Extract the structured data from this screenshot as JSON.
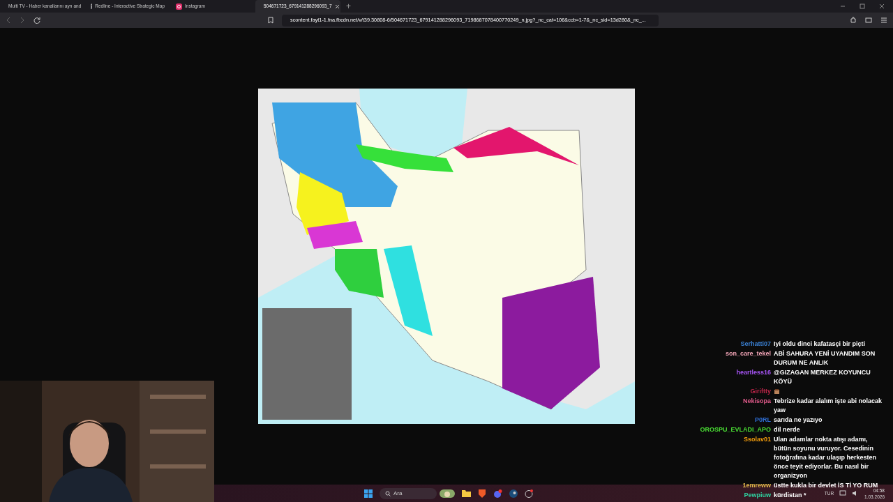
{
  "tabs": [
    {
      "title": "Multi TV - Haber kanallarını ayrı and",
      "selected": false
    },
    {
      "title": "Redline - Interactive Strategic Map",
      "selected": false
    },
    {
      "title": "Instagram",
      "selected": false
    },
    {
      "title": "504671723_679141288296093_7",
      "selected": true
    }
  ],
  "new_tab_button": "+",
  "address_bar": {
    "url": "scontent.fayt1-1.fna.fbcdn.net/v/t39.30808-6/504671723_679141288296093_7198687078400770249_n.jpg?_nc_cat=106&ccb=1-7&_nc_sid=13d280&_nc_..."
  },
  "chat": [
    {
      "user": "Serhatti07",
      "color": "#3b82d6",
      "message": "Iyi oldu dinci kafatasçi bir piçti"
    },
    {
      "user": "son_care_tekel",
      "color": "#f4a6b8",
      "message": "ABİ SAHURA YENİ UYANDIM SON DURUM NE ANLIK"
    },
    {
      "user": "heartless16",
      "color": "#a855f7",
      "message": "@GIZAGAN MERKEZ KOYUNCU KÖYÜ"
    },
    {
      "user": "Giriftty",
      "color": "#c0264a",
      "kind": "emote"
    },
    {
      "user": "Nekisopa",
      "color": "#e05a8a",
      "message": "Tebrize kadar alalım işte abi nolacak yaw"
    },
    {
      "user": "P0RL",
      "color": "#2f6fd6",
      "message": "sarıda ne yazıyo"
    },
    {
      "user": "OROSPU_EVLADI_APO",
      "color": "#4ade34",
      "message": "dil nerde"
    },
    {
      "user": "Ssolav01",
      "color": "#f59e0b",
      "message": "Ulan adamlar nokta atışı adamı, bütün soyunu vuruyor. Cesedinin fotoğrafına kadar ulaşıp herkesten önce teyit ediyorlar. Bu nasıl bir organizyon"
    },
    {
      "user": "1emreww",
      "color": "#e0b84a",
      "message": "üstte kukla bir devlet İS Tİ YO RUM"
    },
    {
      "user": "Pewpiuw",
      "color": "#2fd3a0",
      "message": "kürdistan *"
    }
  ],
  "taskbar": {
    "search": {
      "placeholder": "Ara"
    },
    "language": "TUR",
    "time": "04:58",
    "date": "1.03.2026"
  }
}
